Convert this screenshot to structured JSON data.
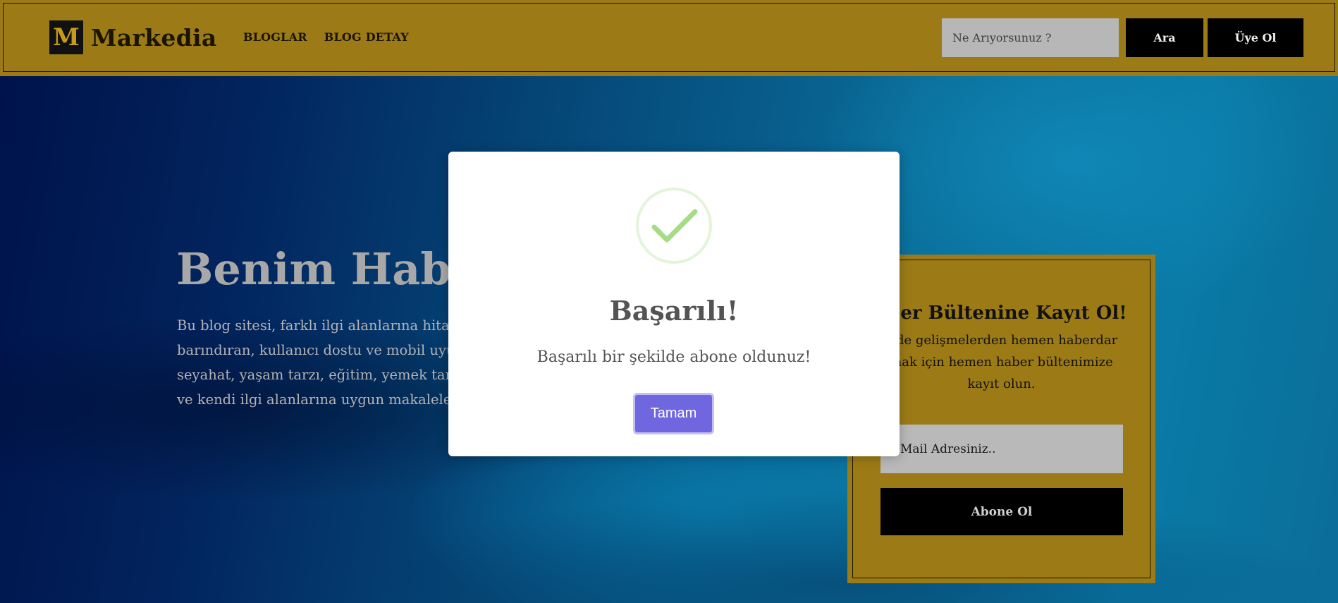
{
  "brand": {
    "logo_letter": "M",
    "name": "Markedia"
  },
  "nav": {
    "items": [
      {
        "label": "BLOGLAR"
      },
      {
        "label": "BLOG DETAY"
      }
    ]
  },
  "header": {
    "search_placeholder": "Ne Arıyorsunuz ?",
    "search_button": "Ara",
    "signup_button": "Üye Ol"
  },
  "hero": {
    "title": "Benim Haber",
    "lines": [
      "Bu blog sitesi, farklı ilgi alanlarına hitap e",
      "barındıran, kullanıcı dostu ve mobil uyum",
      "seyahat, yaşam tarzı, eğitim, yemek tarifl",
      "ve kendi ilgi alanlarına uygun makaleler"
    ]
  },
  "newsletter": {
    "title": "aber Bültenine Kayıt Ol!",
    "lines": [
      "z de gelişmelerden hemen haberdar",
      "mak için hemen haber bültenimize",
      "kayıt olun."
    ],
    "email_placeholder": "Mail Adresiniz..",
    "subscribe_button": "Abone Ol"
  },
  "modal": {
    "icon": "success-check-icon",
    "title": "Başarılı!",
    "message": "Başarılı bir şekilde abone oldunuz!",
    "ok_button": "Tamam"
  },
  "colors": {
    "header_bg": "#9c7b16",
    "accent_gold": "#c79a1c",
    "modal_button": "#7066e0",
    "success_green": "#a5dc86"
  }
}
